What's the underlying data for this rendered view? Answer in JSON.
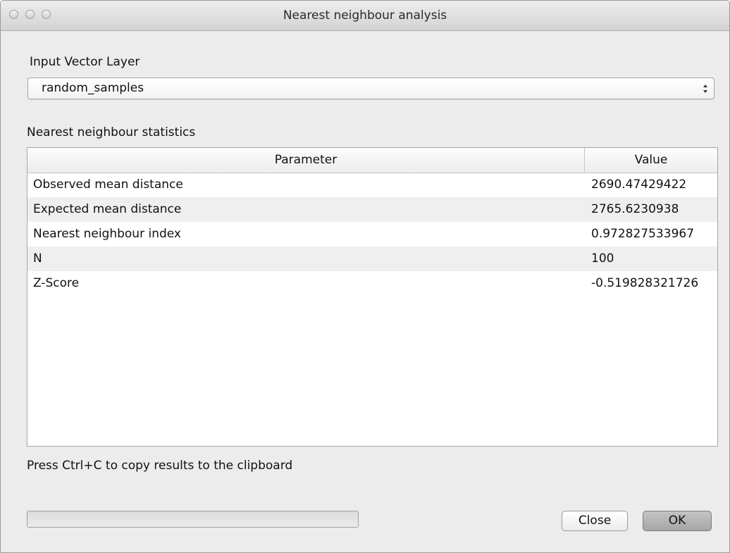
{
  "window": {
    "title": "Nearest neighbour analysis"
  },
  "input": {
    "label": "Input Vector Layer",
    "selected": "random_samples"
  },
  "stats": {
    "label": "Nearest neighbour statistics",
    "columns": [
      "Parameter",
      "Value"
    ],
    "rows": [
      {
        "parameter": "Observed mean distance",
        "value": "2690.47429422"
      },
      {
        "parameter": "Expected mean distance",
        "value": "2765.6230938"
      },
      {
        "parameter": "Nearest neighbour index",
        "value": "0.972827533967"
      },
      {
        "parameter": "N",
        "value": "100"
      },
      {
        "parameter": "Z-Score",
        "value": "-0.519828321726"
      }
    ]
  },
  "hint": "Press Ctrl+C to copy results to the clipboard",
  "progress": {
    "percent": 0
  },
  "buttons": {
    "close": "Close",
    "ok": "OK"
  },
  "icons": {
    "window_controls": [
      "close-icon",
      "minimize-icon",
      "zoom-icon"
    ],
    "combo": "up-down-arrows-icon"
  },
  "colors": {
    "window_bg": "#ececec",
    "alt_row": "#efefef",
    "ok_button": "#b4b4b4"
  }
}
